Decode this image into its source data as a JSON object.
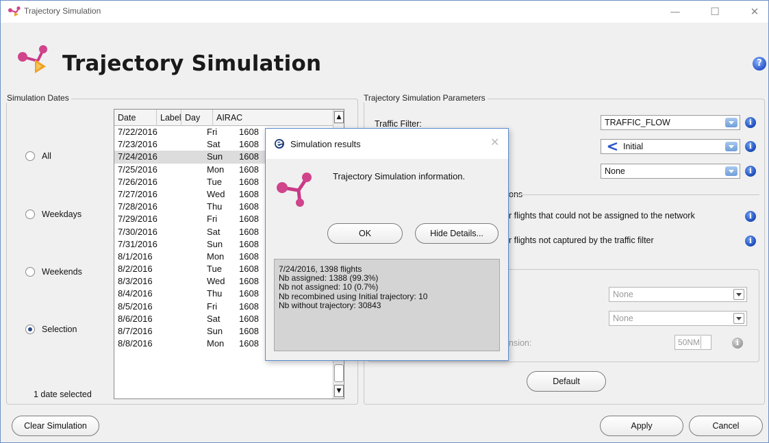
{
  "window": {
    "title": "Trajectory Simulation",
    "controls": {
      "minimize": "—",
      "maximize": "☐",
      "close": "✕"
    }
  },
  "header": {
    "title": "Trajectory Simulation",
    "help": "?"
  },
  "simulation_dates": {
    "group_label": "Simulation Dates",
    "options": [
      {
        "label": "All",
        "checked": false
      },
      {
        "label": "Weekdays",
        "checked": false
      },
      {
        "label": "Weekends",
        "checked": false
      },
      {
        "label": "Selection",
        "checked": true
      }
    ],
    "columns": [
      "Date",
      "Label",
      "Day",
      "AIRAC"
    ],
    "rows": [
      {
        "date": "7/22/2016",
        "label": "",
        "day": "Fri",
        "airac": "1608"
      },
      {
        "date": "7/23/2016",
        "label": "",
        "day": "Sat",
        "airac": "1608"
      },
      {
        "date": "7/24/2016",
        "label": "",
        "day": "Sun",
        "airac": "1608",
        "selected": true
      },
      {
        "date": "7/25/2016",
        "label": "",
        "day": "Mon",
        "airac": "1608"
      },
      {
        "date": "7/26/2016",
        "label": "",
        "day": "Tue",
        "airac": "1608"
      },
      {
        "date": "7/27/2016",
        "label": "",
        "day": "Wed",
        "airac": "1608"
      },
      {
        "date": "7/28/2016",
        "label": "",
        "day": "Thu",
        "airac": "1608"
      },
      {
        "date": "7/29/2016",
        "label": "",
        "day": "Fri",
        "airac": "1608"
      },
      {
        "date": "7/30/2016",
        "label": "",
        "day": "Sat",
        "airac": "1608"
      },
      {
        "date": "7/31/2016",
        "label": "",
        "day": "Sun",
        "airac": "1608"
      },
      {
        "date": "8/1/2016",
        "label": "",
        "day": "Mon",
        "airac": "1608"
      },
      {
        "date": "8/2/2016",
        "label": "",
        "day": "Tue",
        "airac": "1608"
      },
      {
        "date": "8/3/2016",
        "label": "",
        "day": "Wed",
        "airac": "1608"
      },
      {
        "date": "8/4/2016",
        "label": "",
        "day": "Thu",
        "airac": "1608"
      },
      {
        "date": "8/5/2016",
        "label": "",
        "day": "Fri",
        "airac": "1608"
      },
      {
        "date": "8/6/2016",
        "label": "",
        "day": "Sat",
        "airac": "1608"
      },
      {
        "date": "8/7/2016",
        "label": "",
        "day": "Sun",
        "airac": "1608"
      },
      {
        "date": "8/8/2016",
        "label": "",
        "day": "Mon",
        "airac": "1608"
      }
    ],
    "selected_count": "1 date selected"
  },
  "parameters": {
    "group_label": "Trajectory Simulation Parameters",
    "traffic_filter_label": "Traffic Filter:",
    "traffic_filter_value": "TRAFFIC_FLOW",
    "trajectory_value": "Initial",
    "third_value": "None",
    "options_partial_label": "ons",
    "opt1_partial": "r flights that could not be assigned to the network",
    "opt2_partial": "r flights not captured by the traffic filter",
    "disabled_combo1": "None",
    "disabled_combo2": "None",
    "dimension_partial": "nsion:",
    "dimension_value": "50NM",
    "default_button": "Default"
  },
  "footer": {
    "clear_button": "Clear Simulation",
    "apply_button": "Apply",
    "cancel_button": "Cancel"
  },
  "dialog": {
    "title": "Simulation results",
    "message": "Trajectory Simulation information.",
    "ok_button": "OK",
    "details_button": "Hide Details...",
    "details": [
      "7/24/2016, 1398 flights",
      "Nb assigned: 1388 (99.3%)",
      "Nb not assigned: 10 (0.7%)",
      "Nb recombined using Initial trajectory: 10",
      "Nb without trajectory: 30843"
    ],
    "close": "✕"
  },
  "colors": {
    "accent": "#2a55c8",
    "brand_pink": "#d0448c",
    "brand_orange": "#f0a020"
  }
}
